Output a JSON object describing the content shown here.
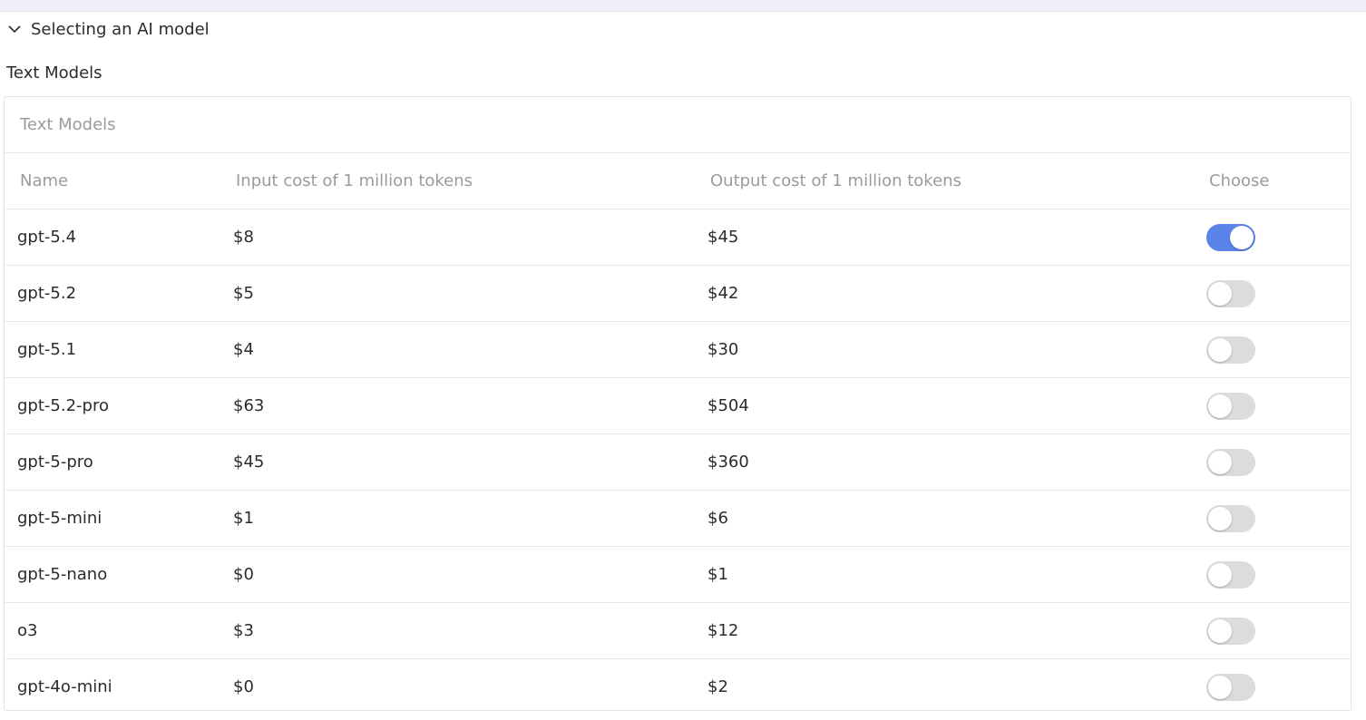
{
  "section": {
    "title": "Selecting an AI model",
    "icon": "chevron-down-icon"
  },
  "subtitle": "Text Models",
  "table": {
    "caption": "Text Models",
    "columns": [
      "Name",
      "Input cost of 1 million tokens",
      "Output cost of 1 million tokens",
      "Choose"
    ],
    "rows": [
      {
        "name": "gpt-5.4",
        "input": "$8",
        "output": "$45",
        "selected": true
      },
      {
        "name": "gpt-5.2",
        "input": "$5",
        "output": "$42",
        "selected": false
      },
      {
        "name": "gpt-5.1",
        "input": "$4",
        "output": "$30",
        "selected": false
      },
      {
        "name": "gpt-5.2-pro",
        "input": "$63",
        "output": "$504",
        "selected": false
      },
      {
        "name": "gpt-5-pro",
        "input": "$45",
        "output": "$360",
        "selected": false
      },
      {
        "name": "gpt-5-mini",
        "input": "$1",
        "output": "$6",
        "selected": false
      },
      {
        "name": "gpt-5-nano",
        "input": "$0",
        "output": "$1",
        "selected": false
      },
      {
        "name": "o3",
        "input": "$3",
        "output": "$12",
        "selected": false
      },
      {
        "name": "gpt-4o-mini",
        "input": "$0",
        "output": "$2",
        "selected": false
      }
    ]
  },
  "colors": {
    "toggle_on": "#5b84ea",
    "toggle_off": "#dcdcdf",
    "header_strip": "#f1eef8"
  }
}
